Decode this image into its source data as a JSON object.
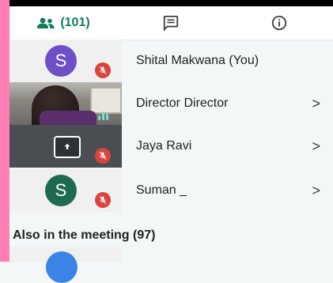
{
  "tabs": {
    "people_count": "(101)",
    "people_icon": "people-icon",
    "chat_icon": "chat-icon",
    "info_icon": "info-icon"
  },
  "participants": [
    {
      "name": "Shital Makwana (You)",
      "avatar_letter": "S",
      "avatar_color": "#6f4fc7",
      "muted": true,
      "has_chevron": false,
      "tile": "avatar"
    },
    {
      "name": "Director Director",
      "has_chevron": true,
      "tile": "video",
      "speaking": true
    },
    {
      "name": "Jaya Ravi",
      "has_chevron": true,
      "tile": "screen-share",
      "muted": true
    },
    {
      "name": "Suman _",
      "avatar_letter": "S",
      "avatar_color": "#1e6a4f",
      "muted": true,
      "has_chevron": true,
      "tile": "avatar"
    }
  ],
  "chevron": ">",
  "also_in_meeting": "Also in the meeting (97)",
  "colors": {
    "accent": "#137a5c",
    "mute_red": "#d9443b",
    "left_strip": "#ff7fb5"
  }
}
